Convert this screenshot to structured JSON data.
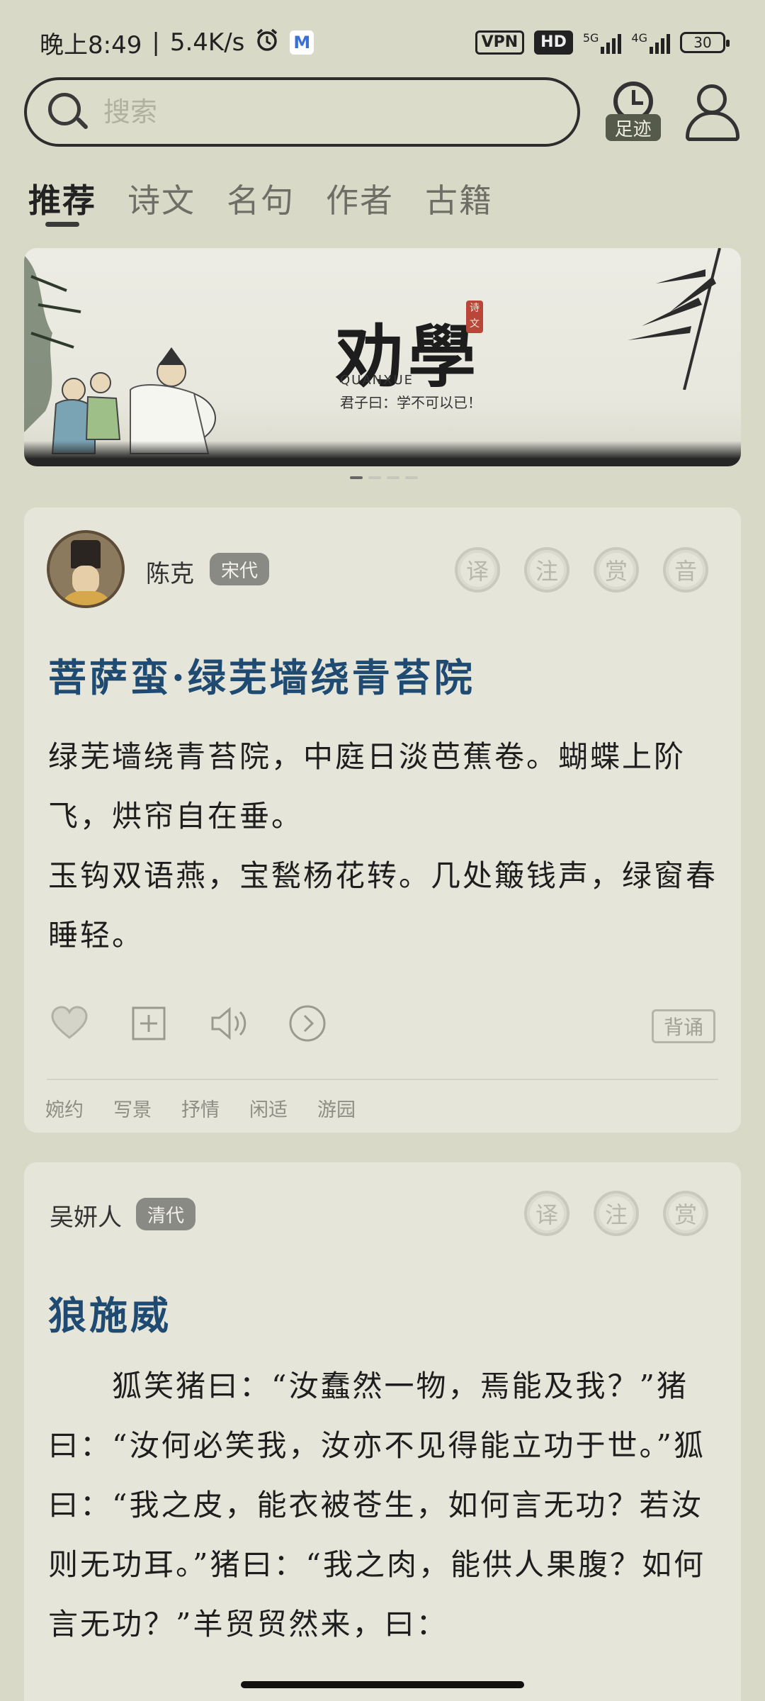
{
  "status_bar": {
    "time": "晚上8:49",
    "net_speed": "5.4K/s",
    "alarm_icon": "alarm-icon",
    "mail_icon": "mail-icon",
    "mail_glyph": "M",
    "vpn": "VPN",
    "hd": "HD",
    "sig1_label": "5G",
    "sig2_label": "4G",
    "battery": "30"
  },
  "search": {
    "placeholder": "搜索",
    "footprint_label": "足迹"
  },
  "tabs": [
    {
      "label": "推荐",
      "active": true
    },
    {
      "label": "诗文",
      "active": false
    },
    {
      "label": "名句",
      "active": false
    },
    {
      "label": "作者",
      "active": false
    },
    {
      "label": "古籍",
      "active": false
    }
  ],
  "banner": {
    "title": "劝學",
    "seal": "诗文",
    "subtitle": "QUANXUE",
    "quote": "君子曰：学不可以已！",
    "page_count": 4,
    "active_index": 0
  },
  "cards": [
    {
      "author": "陈克",
      "dynasty": "宋代",
      "stamps": [
        "译",
        "注",
        "赏",
        "音"
      ],
      "title": "菩萨蛮·绿芜墙绕青苔院",
      "lines": [
        "绿芜墙绕青苔院，中庭日淡芭蕉卷。蝴蝶上阶飞，烘帘自在垂。",
        "玉钩双语燕，宝甃杨花转。几处簸钱声，绿窗春睡轻。"
      ],
      "recite": "背诵",
      "tags": [
        "婉约",
        "写景",
        "抒情",
        "闲适",
        "游园"
      ]
    },
    {
      "author": "吴妍人",
      "dynasty": "清代",
      "stamps": [
        "译",
        "注",
        "赏"
      ],
      "title": "狼施威",
      "lines": [
        "　　狐笑猪曰：“汝蠢然一物，焉能及我？”猪曰：“汝何必笑我，汝亦不见得能立功于世。”狐曰：“我之皮，能衣被苍生，如何言无功？若汝则无功耳。”猪曰：“我之肉，能供人果腹？如何言无功？”羊贸贸然来，曰："
      ]
    }
  ]
}
